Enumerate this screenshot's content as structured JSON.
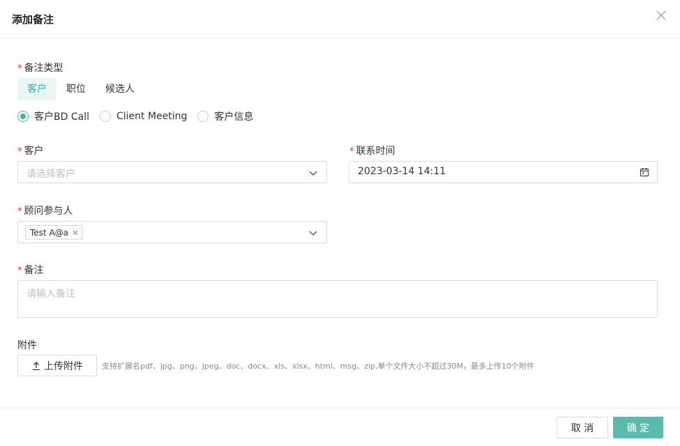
{
  "dialog": {
    "title": "添加备注",
    "close_icon": "close-icon"
  },
  "note_type": {
    "label": "备注类型",
    "tabs": [
      {
        "label": "客户",
        "active": true
      },
      {
        "label": "职位",
        "active": false
      },
      {
        "label": "候选人",
        "active": false
      }
    ],
    "options": [
      {
        "label": "客户BD Call",
        "checked": true
      },
      {
        "label": "Client Meeting",
        "checked": false
      },
      {
        "label": "客户信息",
        "checked": false
      }
    ]
  },
  "customer": {
    "label": "客户",
    "placeholder": "请选择客户"
  },
  "contact_time": {
    "label": "联系时间",
    "value": "2023-03-14 14:11"
  },
  "participants": {
    "label": "顾问参与人",
    "tags": [
      "Test A@a"
    ]
  },
  "note": {
    "label": "备注",
    "placeholder": "请输入备注"
  },
  "attachment": {
    "label": "附件",
    "upload_label": "上传附件",
    "hint": "支持扩展名pdf、jpg、png、jpeg、doc、docx、xls、xlsx、html、msg、zip,单个文件大小不超过30M，最多上传10个附件"
  },
  "footer": {
    "cancel_label": "取 消",
    "ok_label": "确 定"
  },
  "required_mark": "*",
  "colors": {
    "accent": "#3fb0a2",
    "primary_button": "#5bb9ae",
    "required": "#e0362c"
  }
}
